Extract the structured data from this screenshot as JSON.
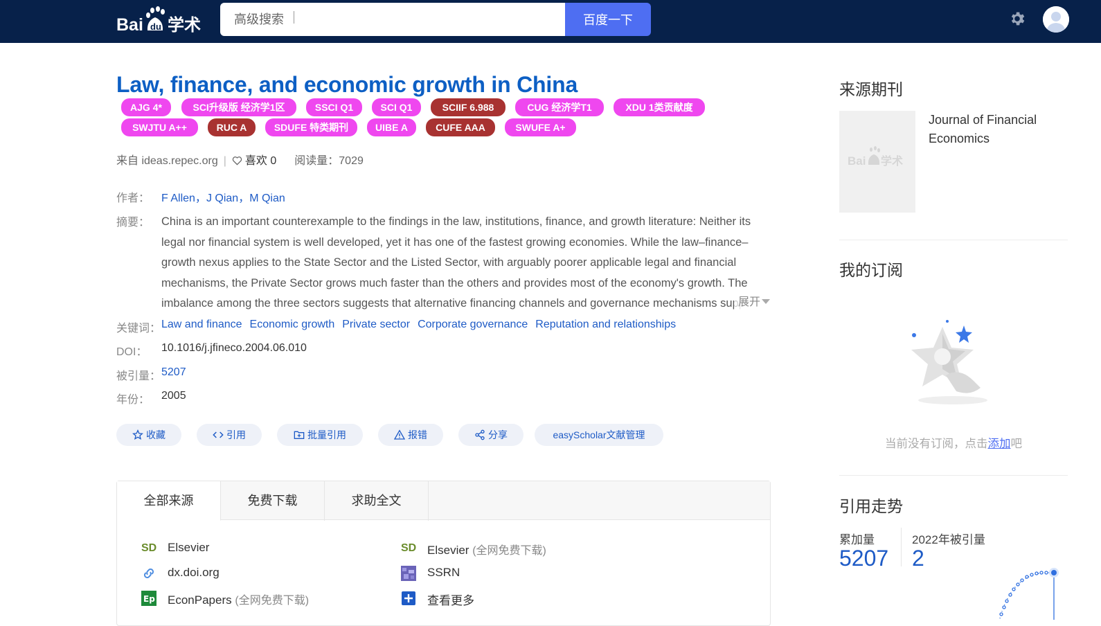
{
  "search": {
    "placeholder": "高级搜索",
    "button": "百度一下"
  },
  "paper": {
    "title": "Law, finance, and economic growth in China",
    "badges": [
      {
        "label": "AJG 4*",
        "color": "#ef47ef"
      },
      {
        "label": "SCI升级版 经济学1区",
        "color": "#ef47ef"
      },
      {
        "label": "SSCI Q1",
        "color": "#ef47ef"
      },
      {
        "label": "SCI Q1",
        "color": "#ef47ef"
      },
      {
        "label": "SCIIF 6.988",
        "color": "#a83231"
      },
      {
        "label": "CUG 经济学T1",
        "color": "#ef47ef"
      },
      {
        "label": "XDU 1类贡献度",
        "color": "#ef47ef"
      },
      {
        "label": "SWJTU A++",
        "color": "#ef47ef"
      },
      {
        "label": "RUC A",
        "color": "#a83231"
      },
      {
        "label": "SDUFE 特类期刊",
        "color": "#ef47ef"
      },
      {
        "label": "UIBE A",
        "color": "#ef47ef"
      },
      {
        "label": "CUFE AAA",
        "color": "#a83231"
      },
      {
        "label": "SWUFE A+",
        "color": "#ef47ef"
      }
    ],
    "source": "来自 ideas.repec.org",
    "likes": "喜欢 0",
    "reads": "阅读量：7029",
    "labels": {
      "authors": "作者：",
      "abstract": "摘要：",
      "keywords": "关键词：",
      "doi": "DOI：",
      "cited": "被引量：",
      "year": "年份："
    },
    "authors": [
      "F Allen",
      "J Qian",
      "M Qian"
    ],
    "author_sep": "，",
    "abstract": "China is an important counterexample to the findings in the law, institutions, finance, and growth literature: Neither its legal nor financial system is well developed, yet it has one of the fastest growing economies. While the law–finance–growth nexus applies to the State Sector and the Listed Sector, with arguably poorer applicable legal and financial mechanisms, the Private Sector grows much faster than the others and provides most of the economy's growth. The imbalance among the three sectors suggests that alternative financing channels and governance mechanisms support the growth of the Private Sector.",
    "expand": "展开",
    "keywords": [
      "Law and finance",
      "Economic growth",
      "Private sector",
      "Corporate governance",
      "Reputation and relationships"
    ],
    "doi": "10.1016/j.jfineco.2004.06.010",
    "cited": "5207",
    "year": "2005"
  },
  "actions": {
    "collect": "收藏",
    "cite": "引用",
    "batch_cite": "批量引用",
    "report": "报错",
    "share": "分享",
    "easyscholar": "easyScholar文献管理"
  },
  "sources": {
    "tabs": [
      "全部来源",
      "免费下载",
      "求助全文"
    ],
    "items": [
      {
        "name": "Elsevier",
        "free": "",
        "icon": "SD"
      },
      {
        "name": "Elsevier",
        "free": "(全网免费下载)",
        "icon": "SD"
      },
      {
        "name": "dx.doi.org",
        "free": "",
        "icon": "link-icon"
      },
      {
        "name": "SSRN",
        "free": "",
        "icon": "ssrn-icon"
      },
      {
        "name": "EconPapers",
        "free": "(全网免费下载)",
        "icon": "Ep"
      },
      {
        "name": "查看更多",
        "free": "",
        "icon": "plus-icon"
      }
    ]
  },
  "sidebar": {
    "journal_title": "来源期刊",
    "journal_name": "Journal of Financial Economics",
    "subscription_title": "我的订阅",
    "subscription_text": "当前没有订阅，点击",
    "subscription_link": "添加",
    "subscription_suffix": "吧",
    "trend_title": "引用走势",
    "total_label": "累加量",
    "total_value": "5207",
    "year_label": "2022年被引量",
    "year_value": "2"
  }
}
